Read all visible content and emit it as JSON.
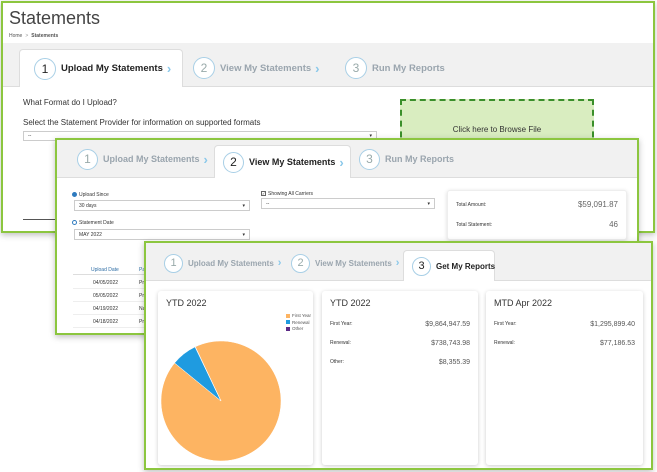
{
  "panel1": {
    "title": "Statements",
    "breadcrumb": {
      "home": "Home",
      "separator": ">",
      "current": "Statements"
    },
    "tabs": [
      {
        "num": "1",
        "label": "Upload My Statements"
      },
      {
        "num": "2",
        "label": "View My Statements"
      },
      {
        "num": "3",
        "label": "Run My Reports"
      }
    ],
    "format_heading": "What Format do I Upload?",
    "provider_prompt": "Select the Statement Provider for information on supported formats",
    "provider_value": "--",
    "browse_label": "Click here to Browse File"
  },
  "panel2": {
    "tabs": [
      {
        "num": "1",
        "label": "Upload My Statements"
      },
      {
        "num": "2",
        "label": "View My Statements"
      },
      {
        "num": "3",
        "label": "Run My Reports"
      }
    ],
    "upload_since_label": "Upload Since",
    "upload_since_value": "30 days",
    "statement_date_label": "Statement Date",
    "statement_date_value": "MAY 2022",
    "carriers_label": "Showing All Carriers",
    "carriers_value": "--",
    "total_amount_label": "Total Amount:",
    "total_amount_value": "$59,091.87",
    "total_statement_label": "Total Statement:",
    "total_statement_value": "46",
    "table": {
      "headers": [
        "Upload Date",
        "Pa"
      ],
      "rows": [
        [
          "04/05/2022",
          "Pr"
        ],
        [
          "05/05/2022",
          "Pr"
        ],
        [
          "04/19/2022",
          "Na"
        ],
        [
          "04/18/2022",
          "Pr"
        ]
      ]
    }
  },
  "panel3": {
    "tabs": [
      {
        "num": "1",
        "label": "Upload My Statements"
      },
      {
        "num": "2",
        "label": "View My Statements"
      },
      {
        "num": "3",
        "label": "Get My Reports"
      }
    ],
    "cards": [
      {
        "title": "YTD 2022"
      },
      {
        "title": "YTD 2022",
        "rows": [
          {
            "label": "First Year:",
            "value": "$9,864,947.59"
          },
          {
            "label": "Renewal:",
            "value": "$738,743.98"
          },
          {
            "label": "Other:",
            "value": "$8,355.39"
          }
        ]
      },
      {
        "title": "MTD Apr 2022",
        "rows": [
          {
            "label": "First Year:",
            "value": "$1,295,899.40"
          },
          {
            "label": "Renewal:",
            "value": "$77,186.53"
          }
        ]
      }
    ],
    "pie": {
      "legend": [
        {
          "label": "First Year",
          "color": "#fdb462"
        },
        {
          "label": "Renewal",
          "color": "#1f9be0"
        },
        {
          "label": "Other",
          "color": "#5b2a86"
        }
      ]
    }
  },
  "chart_data": {
    "type": "pie",
    "title": "YTD 2022",
    "categories": [
      "First Year",
      "Renewal",
      "Other"
    ],
    "values": [
      9864947.59,
      738743.98,
      8355.39
    ],
    "colors": [
      "#fdb462",
      "#1f9be0",
      "#5b2a86"
    ],
    "legend": "top-right"
  }
}
